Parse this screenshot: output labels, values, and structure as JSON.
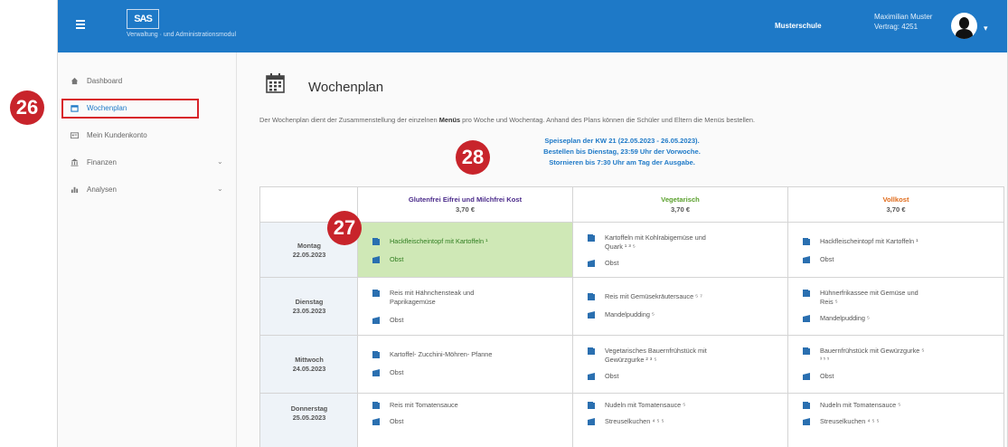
{
  "app": {
    "logo": "SAS",
    "logo_subtitle": "Verwaltung · und Administrationsmodul",
    "school": "Musterschule",
    "user_name": "Maximilian Muster",
    "user_id": "Vertrag: 4251"
  },
  "sidebar": {
    "items": [
      {
        "label": "Dashboard",
        "icon": "home-icon"
      },
      {
        "label": "Wochenplan",
        "icon": "calendar-icon"
      },
      {
        "label": "Mein Kundenkonto",
        "icon": "id-card-icon"
      },
      {
        "label": "Finanzen",
        "icon": "bank-icon"
      },
      {
        "label": "Analysen",
        "icon": "bar-chart-icon"
      }
    ]
  },
  "page": {
    "title": "Wochenplan",
    "desc_pre": "Der Wochenplan dient der Zusammenstellung der einzelnen ",
    "desc_bold": "Menüs",
    "desc_post": " pro Woche und Wochentag. Anhand des Plans können die Schüler und Eltern die Menüs bestellen.",
    "speiseplan_line1": "Speiseplan der KW 21 (22.05.2023 - 26.05.2023).",
    "speiseplan_line2": "Bestellen bis Dienstag, 23:59 Uhr der Vorwoche.",
    "speiseplan_line3": "Stornieren bis 7:30 Uhr am Tag der Ausgabe."
  },
  "plan": {
    "columns": [
      {
        "name": "Glutenfrei Eifrei und Milchfrei Kost",
        "price": "3,70 €",
        "color": "#4a2a8a"
      },
      {
        "name": "Vegetarisch",
        "price": "3,70 €",
        "color": "#5aa02c"
      },
      {
        "name": "Vollkost",
        "price": "3,70 €",
        "color": "#e06b1a"
      }
    ],
    "days": [
      {
        "day": "Montag",
        "date": "22.05.2023",
        "cells": [
          {
            "main": "Hackfleischeintopf mit Kartoffeln ¹",
            "dessert": "Obst",
            "selected": true
          },
          {
            "main": "Kartoffeln mit Kohlrabigemüse und",
            "main2": "Quark ¹ ³ ⁵",
            "dessert": "Obst",
            "selected": false
          },
          {
            "main": "Hackfleischeintopf mit Kartoffeln ¹",
            "dessert": "Obst",
            "selected": false
          }
        ]
      },
      {
        "day": "Dienstag",
        "date": "23.05.2023",
        "cells": [
          {
            "main": "Reis mit Hähnchensteak und",
            "main2": "Paprikagemüse",
            "dessert": "Obst",
            "selected": false
          },
          {
            "main": "Reis mit Gemüsekräutersauce ⁵ ⁷",
            "dessert": "Mandelpudding ⁵",
            "selected": false
          },
          {
            "main": "Hühnerfrikassee mit Gemüse und",
            "main2": "Reis ⁵",
            "dessert": "Mandelpudding ⁵",
            "selected": false
          }
        ]
      },
      {
        "day": "Mittwoch",
        "date": "24.05.2023",
        "cells": [
          {
            "main": "Kartoffel- Zucchini-Möhren- Pfanne",
            "dessert": "Obst",
            "selected": false
          },
          {
            "main": "Vegetarisches Bauernfrühstück mit",
            "main2": "Gewürzgurke ² ³ ⁵",
            "dessert": "Obst",
            "selected": false
          },
          {
            "main": "Bauernfrühstück mit Gewürzgurke ⁵",
            "main2": "³ ⁵ ⁵",
            "dessert": "Obst",
            "selected": false
          }
        ]
      },
      {
        "day": "Donnerstag",
        "date": "25.05.2023",
        "cells": [
          {
            "main": "Reis mit Tomatensauce",
            "dessert": "Obst",
            "selected": false
          },
          {
            "main": "Nudeln mit Tomatensauce ⁵",
            "dessert": "Streuselkuchen ⁴ ⁵ ⁵",
            "selected": false
          },
          {
            "main": "Nudeln mit Tomatensauce ⁵",
            "dessert": "Streuselkuchen ⁴ ⁵ ⁵",
            "selected": false
          }
        ]
      }
    ]
  },
  "callouts": {
    "c26": "26",
    "c27": "27",
    "c28": "28"
  },
  "colors": {
    "topbar": "#1e79c7",
    "callout": "#c8242b",
    "selected_cell": "#cfe8b6",
    "day_cell": "#eef3f8"
  }
}
